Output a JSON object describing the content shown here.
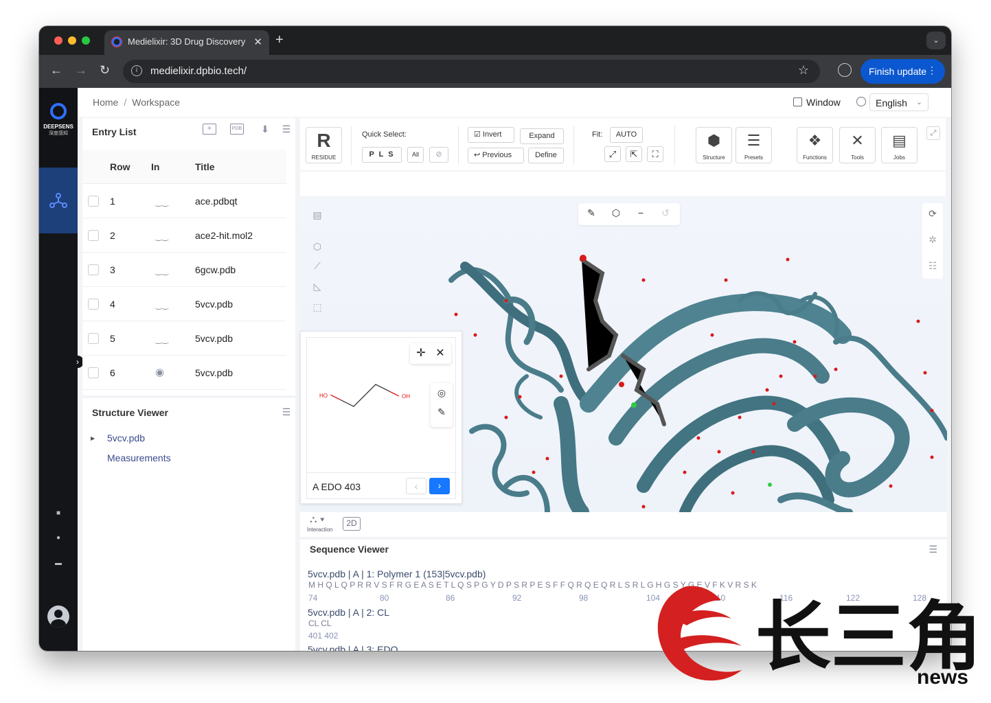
{
  "browser": {
    "tab_title": "Medielixir: 3D Drug Discovery",
    "url": "medielixir.dpbio.tech/",
    "finish_update": "Finish update"
  },
  "sidebar": {
    "brand": "DEEPSENS",
    "brand_sub": "深度感知"
  },
  "topbar": {
    "breadcrumb_home": "Home",
    "breadcrumb_sep": "/",
    "breadcrumb_current": "Workspace",
    "window_label": "Window",
    "language": "English"
  },
  "entry_list": {
    "title": "Entry List",
    "icon_pdb": "PDB",
    "columns": {
      "row": "Row",
      "in": "In",
      "title": "Title"
    },
    "rows": [
      {
        "row": "1",
        "title": "ace.pdbqt",
        "visible": false
      },
      {
        "row": "2",
        "title": "ace2-hit.mol2",
        "visible": false
      },
      {
        "row": "3",
        "title": "6gcw.pdb",
        "visible": false
      },
      {
        "row": "4",
        "title": "5vcv.pdb",
        "visible": false
      },
      {
        "row": "5",
        "title": "5vcv.pdb",
        "visible": false
      },
      {
        "row": "6",
        "title": "5vcv.pdb",
        "visible": true
      }
    ]
  },
  "structure_viewer": {
    "title": "Structure Viewer",
    "items": [
      "5vcv.pdb",
      "Measurements"
    ]
  },
  "toolbar": {
    "residue_glyph": "R",
    "residue_label": "RESIDUE",
    "quick_select_label": "Quick Select:",
    "quick_select_value": "P L S",
    "all_label": "All",
    "invert": "Invert",
    "expand": "Expand",
    "previous": "Previous",
    "define": "Define",
    "fit_label": "Fit:",
    "auto": "AUTO",
    "structure": "Structure",
    "presets": "Presets",
    "functions": "Functions",
    "tools": "Tools",
    "jobs": "Jobs"
  },
  "molecule_panel": {
    "name": "A EDO 403",
    "atom_left": "HO",
    "atom_right": "OH"
  },
  "bottom_tools": {
    "interaction": "Interaction",
    "two_d": "2D"
  },
  "sequence_viewer": {
    "title": "Sequence Viewer",
    "chains": [
      {
        "header": "5vcv.pdb | A | 1: Polymer 1 (153|5vcv.pdb)",
        "residues": "M H Q L Q P R R V S F R G E A S E T L Q S P G Y D P S R P E S F F Q R Q E Q R L S R L G H G S Y G E V F K V R S K",
        "numbers": [
          "74",
          "80",
          "86",
          "92",
          "98",
          "104",
          "110",
          "116",
          "122",
          "128"
        ]
      },
      {
        "header": "5vcv.pdb | A | 2: CL",
        "residues": "CL  CL",
        "numbers_text": "401 402"
      },
      {
        "header": "5vcv.pdb | A | 3: EDO"
      }
    ]
  },
  "watermark": {
    "text": "长三角",
    "news": "news"
  },
  "colors": {
    "accent": "#2f6fff",
    "sidebar_bg": "#141518",
    "sidebar_active": "#1d3f7a",
    "protein": "#4a7c8a",
    "water": "#d81b1b",
    "finish_btn": "#0b57d0"
  }
}
